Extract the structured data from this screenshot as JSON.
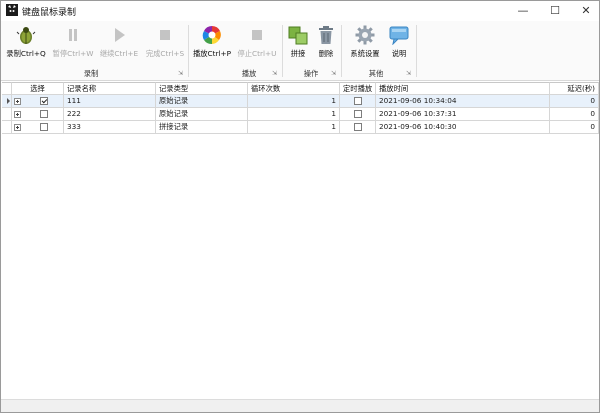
{
  "window": {
    "title": "键盘鼠标录制",
    "controls": {
      "minimize": "—",
      "maximize": "☐",
      "close": "✕"
    }
  },
  "ribbon": {
    "groups": [
      {
        "label": "录制",
        "buttons": [
          {
            "label": "录制Ctrl+Q",
            "icon": "record-bug-icon",
            "enabled": true
          },
          {
            "label": "暂停Ctrl+W",
            "icon": "pause-icon",
            "enabled": false
          },
          {
            "label": "继续Ctrl+E",
            "icon": "play-icon",
            "enabled": false
          },
          {
            "label": "完成Ctrl+S",
            "icon": "stop-icon",
            "enabled": false
          }
        ]
      },
      {
        "label": "播放",
        "buttons": [
          {
            "label": "播放Ctrl+P",
            "icon": "color-wheel-icon",
            "enabled": true
          },
          {
            "label": "停止Ctrl+U",
            "icon": "stop-icon",
            "enabled": false
          }
        ]
      },
      {
        "label": "操作",
        "buttons": [
          {
            "label": "拼接",
            "icon": "merge-icon",
            "enabled": true
          },
          {
            "label": "删除",
            "icon": "trash-icon",
            "enabled": true
          }
        ]
      },
      {
        "label": "其他",
        "buttons": [
          {
            "label": "系统设置",
            "icon": "gear-icon",
            "enabled": true
          },
          {
            "label": "说明",
            "icon": "speech-bubble-icon",
            "enabled": true
          }
        ]
      }
    ]
  },
  "grid": {
    "columns": [
      "选择",
      "记录名称",
      "记录类型",
      "循环次数",
      "定时播放",
      "播放时间",
      "延迟(秒)"
    ],
    "rows": [
      {
        "selected": true,
        "checked": true,
        "name": "111",
        "type": "原始记录",
        "loops": "1",
        "timed": false,
        "time": "2021-09-06 10:34:04",
        "delay": "0"
      },
      {
        "selected": false,
        "checked": false,
        "name": "222",
        "type": "原始记录",
        "loops": "1",
        "timed": false,
        "time": "2021-09-06 10:37:31",
        "delay": "0"
      },
      {
        "selected": false,
        "checked": false,
        "name": "333",
        "type": "拼接记录",
        "loops": "1",
        "timed": false,
        "time": "2021-09-06 10:40:30",
        "delay": "0"
      }
    ]
  },
  "colors": {
    "selected_row": "#e8f1fb",
    "accent": "#3a8ee6"
  }
}
